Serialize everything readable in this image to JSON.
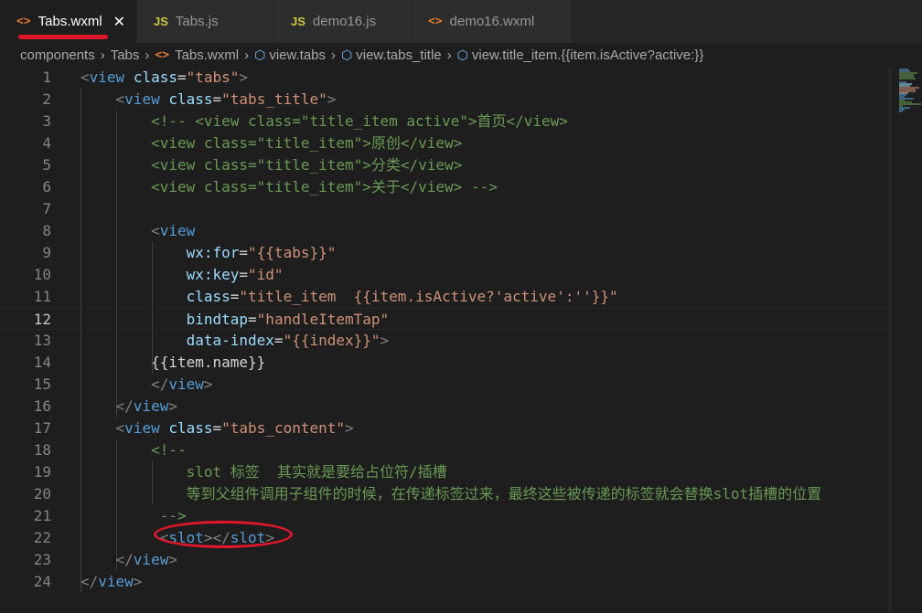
{
  "tabs": [
    {
      "icon": "<>",
      "label": "Tabs.wxml",
      "active": true
    },
    {
      "icon": "JS",
      "label": "Tabs.js",
      "active": false
    },
    {
      "icon": "JS",
      "label": "demo16.js",
      "active": false
    },
    {
      "icon": "<>",
      "label": "demo16.wxml",
      "active": false
    }
  ],
  "close_glyph": "✕",
  "breadcrumbs": [
    "components",
    "Tabs",
    "Tabs.wxml",
    "view.tabs",
    "view.tabs_title",
    "view.title_item.{{item.isActive?active:}}"
  ],
  "editor": {
    "current_line": 12,
    "lines": [
      {
        "n": "1",
        "parts": [
          [
            "br",
            "<"
          ],
          [
            "tag",
            "view"
          ],
          [
            "t",
            " "
          ],
          [
            "attr",
            "class"
          ],
          [
            "t",
            "="
          ],
          [
            "str",
            "\"tabs\""
          ],
          [
            "br",
            ">"
          ]
        ]
      },
      {
        "n": "2",
        "parts": [
          [
            "t",
            "    "
          ],
          [
            "br",
            "<"
          ],
          [
            "tag",
            "view"
          ],
          [
            "t",
            " "
          ],
          [
            "attr",
            "class"
          ],
          [
            "t",
            "="
          ],
          [
            "str",
            "\"tabs_title\""
          ],
          [
            "br",
            ">"
          ]
        ]
      },
      {
        "n": "3",
        "parts": [
          [
            "t",
            "        "
          ],
          [
            "cm",
            "<!-- <view class=\"title_item active\">首页</view>"
          ]
        ]
      },
      {
        "n": "4",
        "parts": [
          [
            "t",
            "        "
          ],
          [
            "cm",
            "<view class=\"title_item\">原创</view>"
          ]
        ]
      },
      {
        "n": "5",
        "parts": [
          [
            "t",
            "        "
          ],
          [
            "cm",
            "<view class=\"title_item\">分类</view>"
          ]
        ]
      },
      {
        "n": "6",
        "parts": [
          [
            "t",
            "        "
          ],
          [
            "cm",
            "<view class=\"title_item\">关于</view> -->"
          ]
        ]
      },
      {
        "n": "7",
        "parts": []
      },
      {
        "n": "8",
        "parts": [
          [
            "t",
            "        "
          ],
          [
            "br",
            "<"
          ],
          [
            "tag",
            "view"
          ]
        ]
      },
      {
        "n": "9",
        "parts": [
          [
            "t",
            "            "
          ],
          [
            "attr",
            "wx:for"
          ],
          [
            "t",
            "="
          ],
          [
            "str",
            "\"{{tabs}}\""
          ]
        ]
      },
      {
        "n": "10",
        "parts": [
          [
            "t",
            "            "
          ],
          [
            "attr",
            "wx:key"
          ],
          [
            "t",
            "="
          ],
          [
            "str",
            "\"id\""
          ]
        ]
      },
      {
        "n": "11",
        "parts": [
          [
            "t",
            "            "
          ],
          [
            "attr",
            "class"
          ],
          [
            "t",
            "="
          ],
          [
            "str",
            "\"title_item  {{item.isActive?'active':''}}\""
          ]
        ]
      },
      {
        "n": "12",
        "parts": [
          [
            "t",
            "            "
          ],
          [
            "attr",
            "bindtap"
          ],
          [
            "t",
            "="
          ],
          [
            "str",
            "\"handleItemTap\""
          ]
        ]
      },
      {
        "n": "13",
        "parts": [
          [
            "t",
            "            "
          ],
          [
            "attr",
            "data-index"
          ],
          [
            "t",
            "="
          ],
          [
            "str",
            "\"{{index}}\""
          ],
          [
            "br",
            ">"
          ]
        ]
      },
      {
        "n": "14",
        "parts": [
          [
            "t",
            "        "
          ],
          [
            "txt",
            "{{item.name}}"
          ]
        ]
      },
      {
        "n": "15",
        "parts": [
          [
            "t",
            "        "
          ],
          [
            "br",
            "</"
          ],
          [
            "tag",
            "view"
          ],
          [
            "br",
            ">"
          ]
        ]
      },
      {
        "n": "16",
        "parts": [
          [
            "t",
            "    "
          ],
          [
            "br",
            "</"
          ],
          [
            "tag",
            "view"
          ],
          [
            "br",
            ">"
          ]
        ]
      },
      {
        "n": "17",
        "parts": [
          [
            "t",
            "    "
          ],
          [
            "br",
            "<"
          ],
          [
            "tag",
            "view"
          ],
          [
            "t",
            " "
          ],
          [
            "attr",
            "class"
          ],
          [
            "t",
            "="
          ],
          [
            "str",
            "\"tabs_content\""
          ],
          [
            "br",
            ">"
          ]
        ]
      },
      {
        "n": "18",
        "parts": [
          [
            "t",
            "        "
          ],
          [
            "cm",
            "<!--"
          ]
        ]
      },
      {
        "n": "19",
        "parts": [
          [
            "t",
            "            "
          ],
          [
            "cm",
            "slot 标签  其实就是要给占位符/插槽"
          ]
        ]
      },
      {
        "n": "20",
        "parts": [
          [
            "t",
            "            "
          ],
          [
            "cm",
            "等到父组件调用子组件的时候，在传递标签过来，最终这些被传递的标签就会替换slot插槽的位置"
          ]
        ]
      },
      {
        "n": "21",
        "parts": [
          [
            "t",
            "         "
          ],
          [
            "cm",
            "-->"
          ]
        ]
      },
      {
        "n": "22",
        "parts": [
          [
            "t",
            "         "
          ],
          [
            "br",
            "<"
          ],
          [
            "tag",
            "slot"
          ],
          [
            "br",
            "></"
          ],
          [
            "tag",
            "slot"
          ],
          [
            "br",
            ">"
          ]
        ]
      },
      {
        "n": "23",
        "parts": [
          [
            "t",
            "    "
          ],
          [
            "br",
            "</"
          ],
          [
            "tag",
            "view"
          ],
          [
            "br",
            ">"
          ]
        ]
      },
      {
        "n": "24",
        "parts": [
          [
            "br",
            "</"
          ],
          [
            "tag",
            "view"
          ],
          [
            "br",
            ">"
          ]
        ]
      }
    ]
  },
  "colors": {
    "annotation": "#e0162b",
    "tag": "#569cd6",
    "attr": "#9cdcfe",
    "string": "#ce9178",
    "comment": "#6a9955"
  }
}
